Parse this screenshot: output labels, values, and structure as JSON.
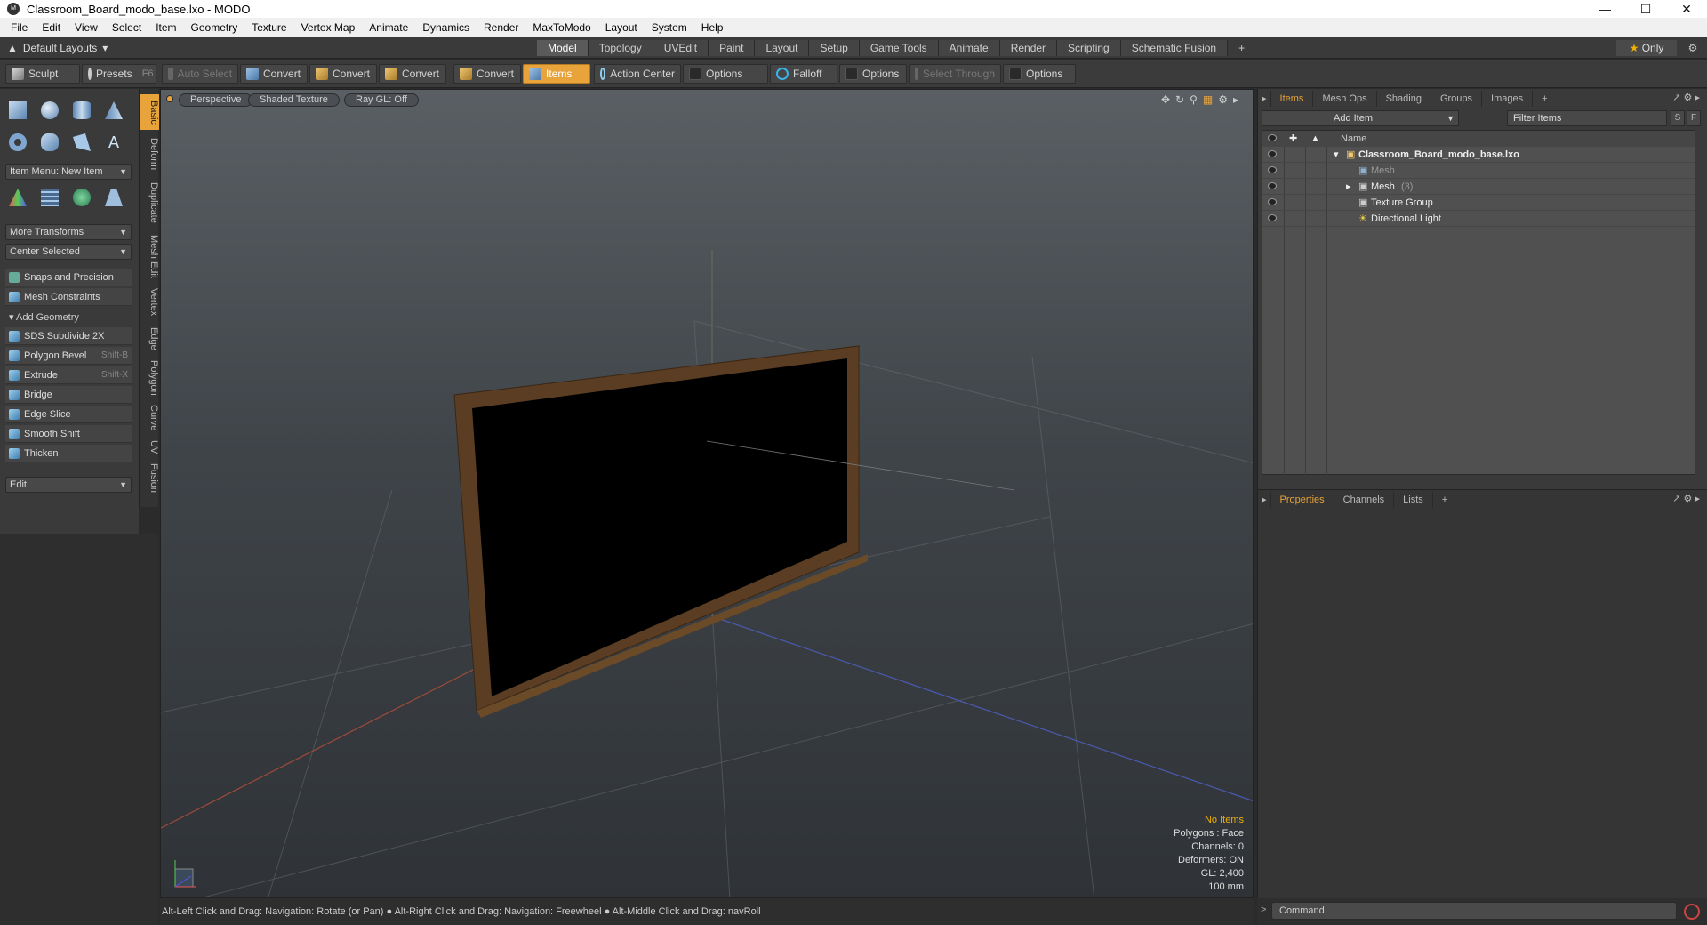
{
  "window": {
    "title": "Classroom_Board_modo_base.lxo - MODO",
    "app_icon": "modo-logo-icon"
  },
  "menu": [
    "File",
    "Edit",
    "View",
    "Select",
    "Item",
    "Geometry",
    "Texture",
    "Vertex Map",
    "Animate",
    "Dynamics",
    "Render",
    "MaxToModo",
    "Layout",
    "System",
    "Help"
  ],
  "layout": {
    "selector": "Default Layouts",
    "tabs": [
      "Model",
      "Topology",
      "UVEdit",
      "Paint",
      "Layout",
      "Setup",
      "Game Tools",
      "Animate",
      "Render",
      "Scripting",
      "Schematic Fusion"
    ],
    "active_tab": "Model",
    "only_label": "Only"
  },
  "toolbar": {
    "sculpt": "Sculpt",
    "presets": "Presets",
    "presets_key": "F6",
    "auto_select": "Auto Select",
    "convert1": "Convert",
    "convert2": "Convert",
    "convert3": "Convert",
    "convert4": "Convert",
    "items": "Items",
    "action_center": "Action Center",
    "options1": "Options",
    "falloff": "Falloff",
    "options2": "Options",
    "select_through": "Select Through",
    "options3": "Options"
  },
  "left": {
    "item_menu": "Item Menu: New Item",
    "more_transforms": "More Transforms",
    "center_selected": "Center Selected",
    "snaps": "Snaps and Precision",
    "mesh_constraints": "Mesh Constraints",
    "add_geometry": "Add Geometry",
    "tools": [
      {
        "label": "SDS Subdivide 2X",
        "key": ""
      },
      {
        "label": "Polygon Bevel",
        "key": "Shift-B"
      },
      {
        "label": "Extrude",
        "key": "Shift-X"
      },
      {
        "label": "Bridge",
        "key": ""
      },
      {
        "label": "Edge Slice",
        "key": ""
      },
      {
        "label": "Smooth Shift",
        "key": ""
      },
      {
        "label": "Thicken",
        "key": ""
      }
    ],
    "edit": "Edit",
    "vtabs": [
      "Basic",
      "Deform",
      "Duplicate",
      "Mesh Edit",
      "Vertex",
      "Edge",
      "Polygon",
      "Curve",
      "UV",
      "Fusion"
    ]
  },
  "viewport": {
    "perspective": "Perspective",
    "shading": "Shaded Texture",
    "raygl": "Ray GL: Off",
    "info": {
      "no_items": "No Items",
      "polygons": "Polygons : Face",
      "channels": "Channels: 0",
      "deformers": "Deformers: ON",
      "gl": "GL: 2,400",
      "scale": "100 mm"
    },
    "colors": {
      "no_items": "#f0b000"
    }
  },
  "items_panel": {
    "tabs": [
      "Items",
      "Mesh Ops",
      "Shading",
      "Groups",
      "Images"
    ],
    "add_item": "Add Item",
    "filter": "Filter Items",
    "s_btn": "S",
    "f_btn": "F",
    "name_header": "Name",
    "rows": [
      {
        "label": "Classroom_Board_modo_base.lxo",
        "count": ""
      },
      {
        "label": "Mesh",
        "count": ""
      },
      {
        "label": "Mesh",
        "count": "(3)"
      },
      {
        "label": "Texture Group",
        "count": ""
      },
      {
        "label": "Directional Light",
        "count": ""
      }
    ]
  },
  "props_panel": {
    "tabs": [
      "Properties",
      "Channels",
      "Lists"
    ]
  },
  "status": "Alt-Left Click and Drag: Navigation: Rotate (or Pan) ● Alt-Right Click and Drag: Navigation: Freewheel ● Alt-Middle Click and Drag: navRoll",
  "command_placeholder": "Command",
  "accent": "#e8a33a"
}
